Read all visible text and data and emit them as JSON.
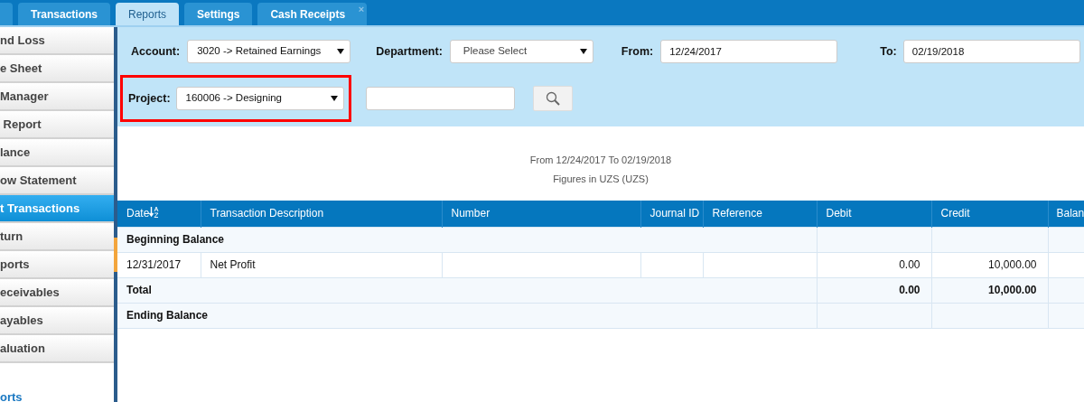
{
  "tabs": [
    {
      "label": "Transactions",
      "selected": false
    },
    {
      "label": "Reports",
      "selected": true
    },
    {
      "label": "Settings",
      "selected": false
    },
    {
      "label": "Cash Receipts",
      "selected": false,
      "close_label": "×"
    }
  ],
  "sidebar": {
    "items": [
      {
        "label": "nd Loss",
        "selected": false
      },
      {
        "label": "e Sheet",
        "selected": false
      },
      {
        "label": "Manager",
        "selected": false
      },
      {
        "label": " Report",
        "selected": false
      },
      {
        "label": "lance",
        "selected": false
      },
      {
        "label": "ow Statement",
        "selected": false
      },
      {
        "label": "t Transactions",
        "selected": true
      },
      {
        "label": "turn",
        "selected": false
      },
      {
        "label": "ports",
        "selected": false
      },
      {
        "label": "eceivables",
        "selected": false
      },
      {
        "label": "ayables",
        "selected": false
      },
      {
        "label": "aluation",
        "selected": false
      }
    ],
    "footer_link": "orts"
  },
  "filters": {
    "account": {
      "label": "Account:",
      "value": "3020 -> Retained Earnings"
    },
    "department": {
      "label": "Department:",
      "value": "Please Select"
    },
    "from": {
      "label": "From:",
      "value": "12/24/2017"
    },
    "to": {
      "label": "To:",
      "value": "02/19/2018"
    },
    "project": {
      "label": "Project:",
      "value": "160006 -> Designing",
      "highlighted": true
    }
  },
  "report_header": {
    "period": "From 12/24/2017 To 02/19/2018",
    "currency": "Figures in UZS (UZS)"
  },
  "table": {
    "columns": [
      {
        "label": "Date",
        "sortable": true
      },
      {
        "label": "Transaction Description",
        "sortable": false
      },
      {
        "label": "Number",
        "sortable": false
      },
      {
        "label": "Journal ID",
        "sortable": false
      },
      {
        "label": "Reference",
        "sortable": false
      },
      {
        "label": "Debit",
        "sortable": false
      },
      {
        "label": "Credit",
        "sortable": false
      },
      {
        "label": "Balan"
      }
    ],
    "rows": [
      {
        "kind": "group",
        "label": "Beginning Balance"
      },
      {
        "kind": "data",
        "cells": [
          "12/31/2017",
          "Net Profit",
          "",
          "",
          "",
          "0.00",
          "10,000.00",
          ""
        ]
      },
      {
        "kind": "total",
        "label": "Total",
        "debit": "0.00",
        "credit": "10,000.00"
      },
      {
        "kind": "group",
        "label": "Ending Balance"
      }
    ]
  }
}
